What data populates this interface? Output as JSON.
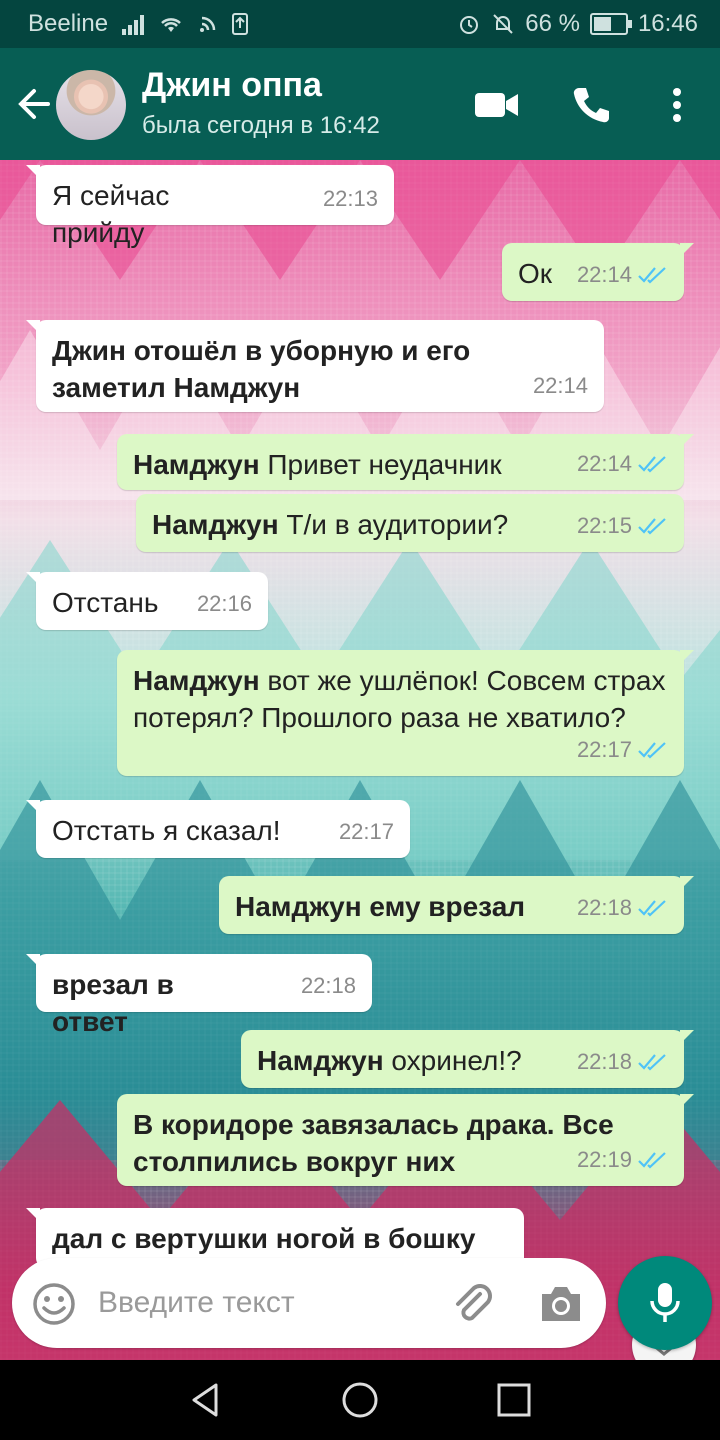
{
  "status_bar": {
    "carrier": "Beeline",
    "battery": "66 %",
    "battery_level": 0.66,
    "time": "16:46"
  },
  "header": {
    "name": "Джин оппа",
    "status": "была сегодня в 16:42"
  },
  "messages": [
    {
      "dir": "in",
      "bold": "",
      "text": "Я сейчас прийду",
      "time": "22:13"
    },
    {
      "dir": "out",
      "bold": "",
      "text": "Ок",
      "time": "22:14"
    },
    {
      "dir": "in",
      "bold": "Джин отошёл в уборную и его заметил Намджун",
      "text": "",
      "time": "22:14"
    },
    {
      "dir": "out",
      "bold": "Намджун",
      "text": " Привет неудачник",
      "time": "22:14"
    },
    {
      "dir": "out",
      "bold": "Намджун",
      "text": " Т/и в аудитории?",
      "time": "22:15"
    },
    {
      "dir": "in",
      "bold": "",
      "text": "Отстань",
      "time": "22:16"
    },
    {
      "dir": "out",
      "bold": "Намджун",
      "text": " вот же ушлёпок! Совсем страх потерял? Прошлого раза не хватило?",
      "time": "22:17"
    },
    {
      "dir": "in",
      "bold": "",
      "text": "Отстать я сказал!",
      "time": "22:17"
    },
    {
      "dir": "out",
      "bold": "Намджун ему врезал",
      "text": "",
      "time": "22:18"
    },
    {
      "dir": "in",
      "bold": "врезал в ответ",
      "text": "",
      "time": "22:18"
    },
    {
      "dir": "out",
      "bold": "Намджун",
      "text": " охринел!?",
      "time": "22:18"
    },
    {
      "dir": "out",
      "bold": "В коридоре завязалась драка. Все столпились вокруг них",
      "text": "",
      "time": "22:19"
    },
    {
      "dir": "in",
      "bold": "дал с вертушки ногой в бошку",
      "text": "",
      "time": ""
    }
  ],
  "input": {
    "placeholder": "Введите текст"
  },
  "colors": {
    "header": "#075e54",
    "status_bar": "#04453f",
    "incoming_bubble": "#ffffff",
    "outgoing_bubble": "#dcf8c6",
    "mic_button": "#00897b",
    "read_ticks": "#4fc3f7"
  },
  "icons": {
    "back": "arrow-left-icon",
    "video": "video-camera-icon",
    "call": "phone-icon",
    "menu": "more-vertical-icon",
    "emoji": "emoji-icon",
    "attach": "paperclip-icon",
    "camera": "camera-icon",
    "mic": "microphone-icon",
    "scroll": "chevron-double-down-icon"
  }
}
